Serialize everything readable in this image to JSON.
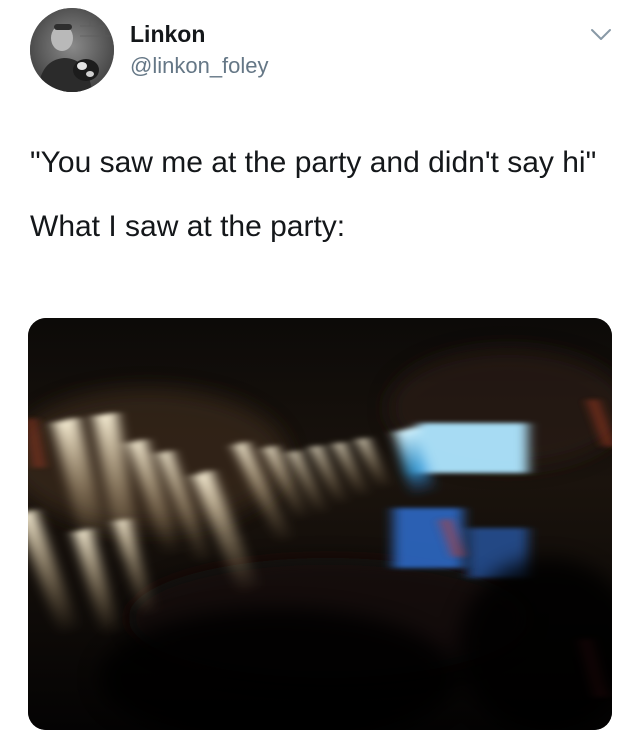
{
  "tweet": {
    "author": {
      "display_name": "Linkon",
      "handle": "@linkon_foley"
    },
    "text_lines": [
      "\"You saw me at the party and didn't say hi\"",
      "What I saw at the party:"
    ]
  },
  "icons": {
    "menu": "chevron-down-icon"
  },
  "colors": {
    "text": "#14171a",
    "secondary": "#657786",
    "media_background": "#050404"
  }
}
